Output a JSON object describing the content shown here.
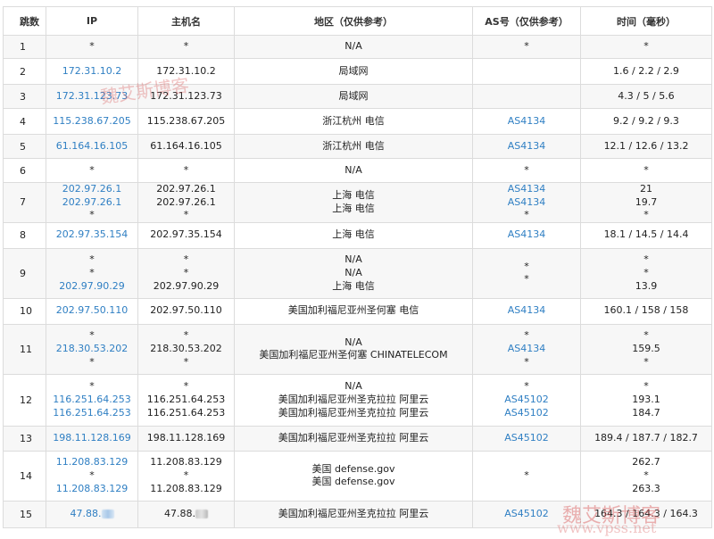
{
  "headers": [
    "跳数",
    "IP",
    "主机名",
    "地区（仅供参考）",
    "AS号（仅供参考）",
    "时间（毫秒）"
  ],
  "rows": [
    {
      "hop": "1",
      "ip": [
        "*"
      ],
      "host": [
        "*"
      ],
      "region": [
        "N/A"
      ],
      "as": [
        "*"
      ],
      "time": [
        "*"
      ]
    },
    {
      "hop": "2",
      "ip": [
        "172.31.10.2"
      ],
      "host": [
        "172.31.10.2"
      ],
      "region": [
        "局域网"
      ],
      "as": [
        ""
      ],
      "time": [
        "1.6 / 2.2 / 2.9"
      ]
    },
    {
      "hop": "3",
      "ip": [
        "172.31.123.73"
      ],
      "host": [
        "172.31.123.73"
      ],
      "region": [
        "局域网"
      ],
      "as": [
        ""
      ],
      "time": [
        "4.3 / 5 / 5.6"
      ]
    },
    {
      "hop": "4",
      "ip": [
        "115.238.67.205"
      ],
      "host": [
        "115.238.67.205"
      ],
      "region": [
        "浙江杭州 电信"
      ],
      "as": [
        "AS4134"
      ],
      "time": [
        "9.2 / 9.2 / 9.3"
      ]
    },
    {
      "hop": "5",
      "ip": [
        "61.164.16.105"
      ],
      "host": [
        "61.164.16.105"
      ],
      "region": [
        "浙江杭州 电信"
      ],
      "as": [
        "AS4134"
      ],
      "time": [
        "12.1 / 12.6 / 13.2"
      ]
    },
    {
      "hop": "6",
      "ip": [
        "*"
      ],
      "host": [
        "*"
      ],
      "region": [
        "N/A"
      ],
      "as": [
        "*"
      ],
      "time": [
        "*"
      ]
    },
    {
      "hop": "7",
      "ip": [
        "202.97.26.1",
        "202.97.26.1",
        "*"
      ],
      "host": [
        "202.97.26.1",
        "202.97.26.1",
        "*"
      ],
      "region": [
        "上海 电信",
        "上海 电信",
        ""
      ],
      "as": [
        "AS4134",
        "AS4134",
        "*"
      ],
      "time": [
        "21",
        "19.7",
        "*"
      ]
    },
    {
      "hop": "8",
      "ip": [
        "202.97.35.154"
      ],
      "host": [
        "202.97.35.154"
      ],
      "region": [
        "上海 电信"
      ],
      "as": [
        "AS4134"
      ],
      "time": [
        "18.1 / 14.5 / 14.4"
      ]
    },
    {
      "hop": "9",
      "ip": [
        "*",
        "*",
        "202.97.90.29"
      ],
      "host": [
        "*",
        "*",
        "202.97.90.29"
      ],
      "region": [
        "N/A",
        "N/A",
        "上海 电信"
      ],
      "as": [
        "*",
        "*",
        ""
      ],
      "time": [
        "*",
        "*",
        "13.9"
      ]
    },
    {
      "hop": "10",
      "ip": [
        "202.97.50.110"
      ],
      "host": [
        "202.97.50.110"
      ],
      "region": [
        "美国加利福尼亚州圣何塞 电信"
      ],
      "as": [
        "AS4134"
      ],
      "time": [
        "160.1 / 158 / 158"
      ]
    },
    {
      "hop": "11",
      "ip": [
        "*",
        "218.30.53.202",
        "*"
      ],
      "host": [
        "*",
        "218.30.53.202",
        "*"
      ],
      "region": [
        "N/A",
        "美国加利福尼亚州圣何塞 CHINATELECOM",
        ""
      ],
      "as": [
        "*",
        "AS4134",
        "*"
      ],
      "time": [
        "*",
        "159.5",
        "*"
      ]
    },
    {
      "hop": "12",
      "ip": [
        "*",
        "116.251.64.253",
        "116.251.64.253"
      ],
      "host": [
        "*",
        "116.251.64.253",
        "116.251.64.253"
      ],
      "region": [
        "N/A",
        "美国加利福尼亚州圣克拉拉 阿里云",
        "美国加利福尼亚州圣克拉拉 阿里云"
      ],
      "as": [
        "*",
        "AS45102",
        "AS45102"
      ],
      "time": [
        "*",
        "193.1",
        "184.7"
      ]
    },
    {
      "hop": "13",
      "ip": [
        "198.11.128.169"
      ],
      "host": [
        "198.11.128.169"
      ],
      "region": [
        "美国加利福尼亚州圣克拉拉 阿里云"
      ],
      "as": [
        "AS45102"
      ],
      "time": [
        "189.4 / 187.7 / 182.7"
      ]
    },
    {
      "hop": "14",
      "ip": [
        "11.208.83.129",
        "*",
        "11.208.83.129"
      ],
      "host": [
        "11.208.83.129",
        "*",
        "11.208.83.129"
      ],
      "region": [
        "美国 defense.gov",
        "",
        "美国 defense.gov"
      ],
      "as": [
        "",
        "*",
        ""
      ],
      "time": [
        "262.7",
        "*",
        "263.3"
      ]
    },
    {
      "hop": "15",
      "ip": [
        "47.88."
      ],
      "host": [
        "47.88."
      ],
      "region": [
        "美国加利福尼亚州圣克拉拉 阿里云"
      ],
      "as": [
        "AS45102"
      ],
      "time": [
        "164.3 / 164.3 / 164.3"
      ],
      "redacted": true
    }
  ],
  "row_heights_hint": "layout-only",
  "watermark": {
    "text": "魏艾斯博客",
    "url_text": "www.vpss.net",
    "color": "#d65555"
  },
  "link_color": "#2f7fc3"
}
